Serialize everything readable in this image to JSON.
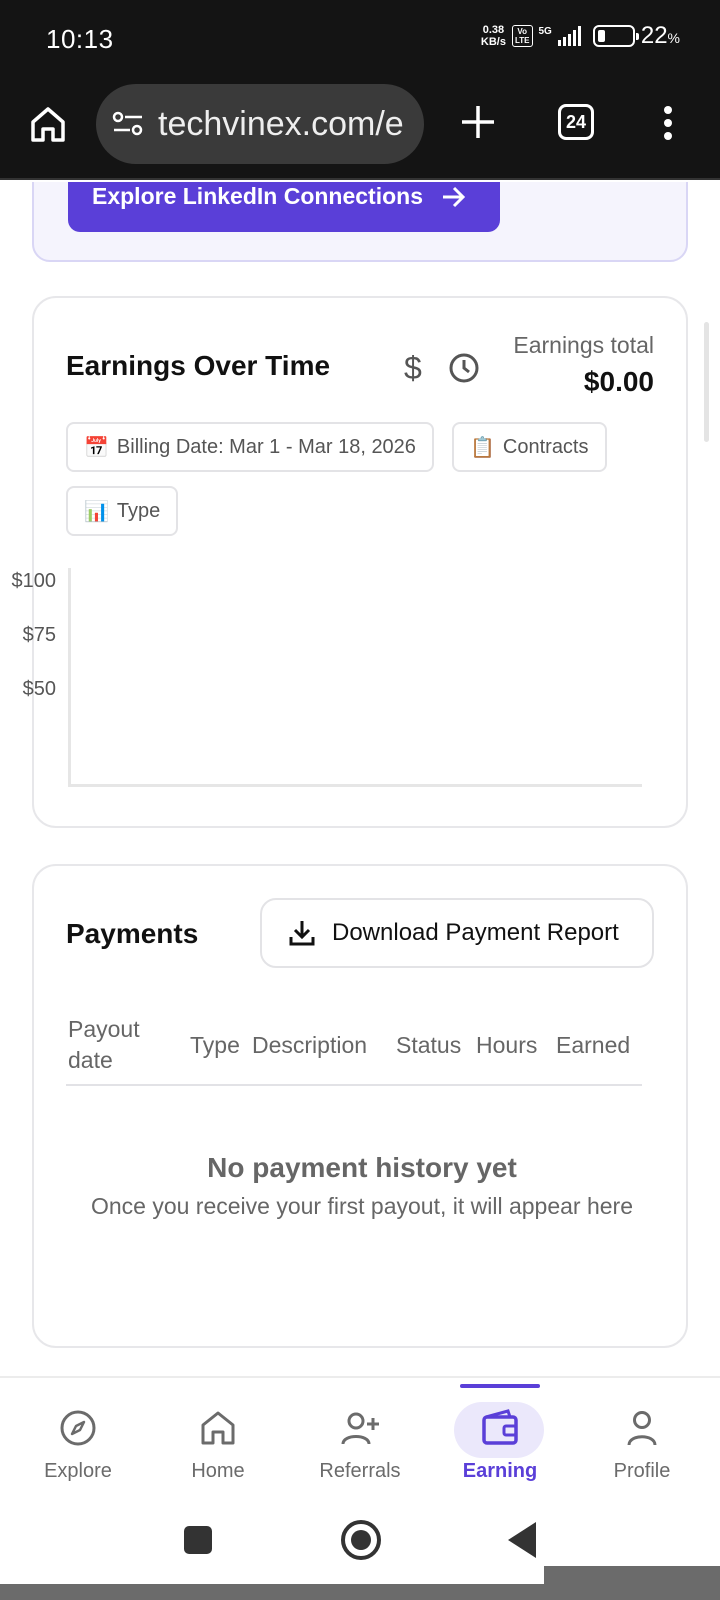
{
  "status_bar": {
    "time": "10:13",
    "net_speed_value": "0.38",
    "net_speed_unit": "KB/s",
    "volte_top": "Vo",
    "volte_bottom": "LTE",
    "network": "5G",
    "battery_percent": "22",
    "battery_unit": "%"
  },
  "browser": {
    "url": "techvinex.com/e",
    "tab_count": "24",
    "icons": [
      "home-icon",
      "site-settings-icon",
      "plus-icon",
      "tabs-icon",
      "menu-icon"
    ]
  },
  "linkedin": {
    "button_label": "Explore LinkedIn Connections",
    "arrow": "→"
  },
  "earnings": {
    "title": "Earnings Over Time",
    "total_label": "Earnings total",
    "total_value": "$0.00",
    "dollar_glyph": "$",
    "chips": {
      "billing_emoji": "📅",
      "billing": "Billing Date: Mar 1 - Mar 18, 2026",
      "contracts_emoji": "📋",
      "contracts": "Contracts",
      "type_emoji": "📊",
      "type": "Type"
    }
  },
  "chart_data": {
    "type": "line",
    "title": "",
    "xlabel": "",
    "ylabel": "",
    "y_ticks": [
      "$100",
      "$75",
      "$50"
    ],
    "series": [],
    "grid": false
  },
  "payments": {
    "title": "Payments",
    "download_label": "Download Payment Report",
    "columns": [
      "Payout date",
      "Type",
      "Description",
      "Status",
      "Hours",
      "Earned"
    ],
    "empty_title": "No payment history yet",
    "empty_subtitle": "Once you receive your first payout, it will appear here"
  },
  "nav": {
    "items": [
      {
        "label": "Explore",
        "icon": "compass-icon"
      },
      {
        "label": "Home",
        "icon": "home-icon"
      },
      {
        "label": "Referrals",
        "icon": "add-user-icon"
      },
      {
        "label": "Earning",
        "icon": "wallet-icon",
        "active": true
      },
      {
        "label": "Profile",
        "icon": "person-icon"
      }
    ],
    "accent_color": "#5a3fd8"
  }
}
